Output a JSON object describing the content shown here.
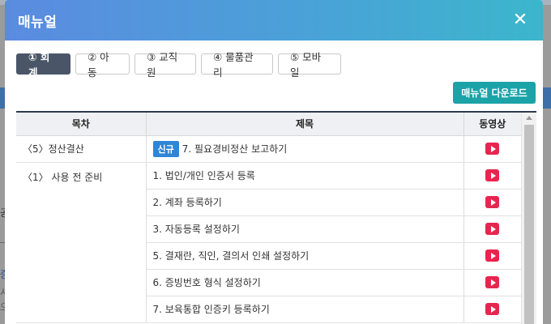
{
  "modal": {
    "title": "매뉴얼",
    "close_icon": "close-icon"
  },
  "tabs": [
    {
      "label": "① 회계",
      "active": true
    },
    {
      "label": "② 아동",
      "active": false
    },
    {
      "label": "③ 교직원",
      "active": false
    },
    {
      "label": "④ 물품관리",
      "active": false
    },
    {
      "label": "⑤ 모바일",
      "active": false
    }
  ],
  "download_label": "매뉴얼 다운로드",
  "table": {
    "headers": [
      "목차",
      "제목",
      "동영상"
    ],
    "rows": [
      {
        "toc": "〈5〉정산결산",
        "badge": "신규",
        "title": "7. 필요경비정산 보고하기"
      },
      {
        "toc": "〈1〉 사용 전 준비",
        "badge": "",
        "title": "1. 법인/개인 인증서 등록"
      },
      {
        "toc": "",
        "badge": "",
        "title": "2. 계좌 등록하기"
      },
      {
        "toc": "",
        "badge": "",
        "title": "3. 자동등록 설정하기"
      },
      {
        "toc": "",
        "badge": "",
        "title": "5. 결재란, 직인, 결의서 인쇄 설정하기"
      },
      {
        "toc": "",
        "badge": "",
        "title": "6. 증빙번호 형식 설정하기"
      },
      {
        "toc": "",
        "badge": "",
        "title": "7. 보육통합 인증키 등록하기"
      }
    ]
  },
  "colors": {
    "header_gradient_start": "#5b8be0",
    "header_gradient_end": "#3cb6cc",
    "active_tab": "#4a5668",
    "download_button": "#1ba3a8",
    "new_badge": "#2f86d6",
    "play_icon": "#e8254f"
  },
  "background": {
    "g1": "공",
    "g2": "증",
    "g3": "시",
    "g4": "으"
  }
}
